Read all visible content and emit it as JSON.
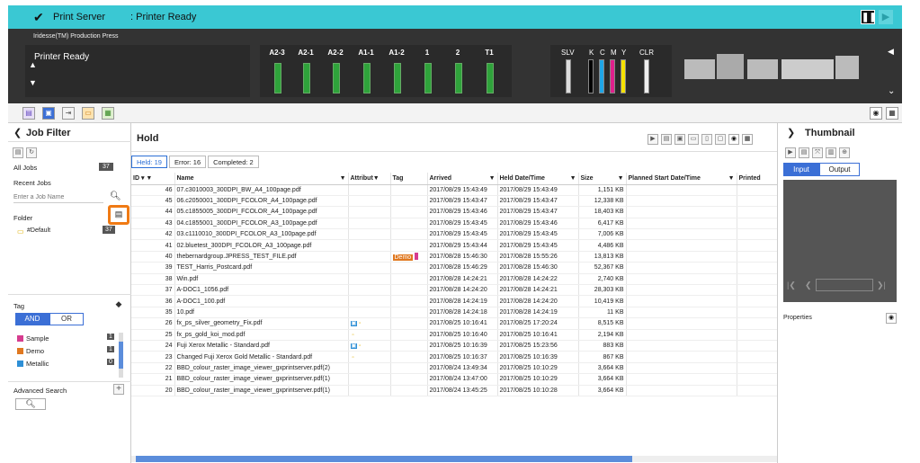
{
  "app": {
    "title": "Print Server",
    "status": ": Printer Ready",
    "product": "Iridesse(TM) Production Press",
    "printer_state": "Printer Ready"
  },
  "trays": [
    {
      "label": "A2-3"
    },
    {
      "label": "A2-1"
    },
    {
      "label": "A2-2"
    },
    {
      "label": "A1-1"
    },
    {
      "label": "A1-2"
    },
    {
      "label": "1"
    },
    {
      "label": "2"
    },
    {
      "label": "T1"
    }
  ],
  "toners": {
    "slv": "SLV",
    "k": "K",
    "c": "C",
    "m": "M",
    "y": "Y",
    "clr": "CLR"
  },
  "left": {
    "title": "Job Filter",
    "all_jobs": "All Jobs",
    "all_count": "37",
    "recent": "Recent Jobs",
    "search_placeholder": "Enter a Job Name",
    "folder": "Folder",
    "default_folder": "#Default",
    "default_count": "37",
    "tag": "Tag",
    "and": "AND",
    "or": "OR",
    "tags": [
      {
        "name": "Sample",
        "count": "1",
        "color": "#d63c8f"
      },
      {
        "name": "Demo",
        "count": "1",
        "color": "#e07820"
      },
      {
        "name": "Metallic",
        "count": "0",
        "color": "#2e8fd6"
      }
    ],
    "advanced": "Advanced Search"
  },
  "center": {
    "title": "Hold",
    "held": "Held: 19",
    "error": "Error: 16",
    "completed": "Completed: 2",
    "columns": {
      "id": "ID",
      "name": "Name",
      "attrib": "Attribut",
      "tag": "Tag",
      "arrived": "Arrived",
      "held": "Held Date/Time",
      "size": "Size",
      "planned": "Planned Start Date/Time",
      "printed": "Printed"
    },
    "rows": [
      {
        "id": "46",
        "name": "07.c3010003_300DPI_BW_A4_100page.pdf",
        "arrived": "2017/08/29 15:43:49",
        "held": "2017/08/29 15:43:49",
        "size": "1,151 KB",
        "tag": ""
      },
      {
        "id": "45",
        "name": "06.c2050001_300DPI_FCOLOR_A4_100page.pdf",
        "arrived": "2017/08/29 15:43:47",
        "held": "2017/08/29 15:43:47",
        "size": "12,338 KB",
        "tag": ""
      },
      {
        "id": "44",
        "name": "05.c1855005_300DPI_FCOLOR_A4_100page.pdf",
        "arrived": "2017/08/29 15:43:46",
        "held": "2017/08/29 15:43:47",
        "size": "18,403 KB",
        "tag": ""
      },
      {
        "id": "43",
        "name": "04.c1855001_300DPI_FCOLOR_A3_100page.pdf",
        "arrived": "2017/08/29 15:43:45",
        "held": "2017/08/29 15:43:46",
        "size": "6,417 KB",
        "tag": ""
      },
      {
        "id": "42",
        "name": "03.c1110010_300DPI_FCOLOR_A3_100page.pdf",
        "arrived": "2017/08/29 15:43:45",
        "held": "2017/08/29 15:43:45",
        "size": "7,006 KB",
        "tag": ""
      },
      {
        "id": "41",
        "name": "02.bluetest_300DPI_FCOLOR_A3_100page.pdf",
        "arrived": "2017/08/29 15:43:44",
        "held": "2017/08/29 15:43:45",
        "size": "4,486 KB",
        "tag": ""
      },
      {
        "id": "40",
        "name": "thebernardgroup.JPRESS_TEST_FILE.pdf",
        "arrived": "2017/08/28 15:46:30",
        "held": "2017/08/28 15:55:26",
        "size": "13,813 KB",
        "tag": "Demo"
      },
      {
        "id": "39",
        "name": "TEST_Harris_Postcard.pdf",
        "arrived": "2017/08/28 15:46:29",
        "held": "2017/08/28 15:46:30",
        "size": "52,367 KB",
        "tag": ""
      },
      {
        "id": "38",
        "name": "Win.pdf",
        "arrived": "2017/08/28 14:24:21",
        "held": "2017/08/28 14:24:22",
        "size": "2,740 KB",
        "tag": ""
      },
      {
        "id": "37",
        "name": "A-DOC1_1056.pdf",
        "arrived": "2017/08/28 14:24:20",
        "held": "2017/08/28 14:24:21",
        "size": "28,303 KB",
        "tag": ""
      },
      {
        "id": "36",
        "name": "A-DOC1_100.pdf",
        "arrived": "2017/08/28 14:24:19",
        "held": "2017/08/28 14:24:20",
        "size": "10,419 KB",
        "tag": ""
      },
      {
        "id": "35",
        "name": "10.pdf",
        "arrived": "2017/08/28 14:24:18",
        "held": "2017/08/28 14:24:19",
        "size": "11 KB",
        "tag": ""
      },
      {
        "id": "26",
        "name": "fx_ps_silver_geometry_Fix.pdf",
        "arrived": "2017/08/25 10:16:41",
        "held": "2017/08/25 17:20:24",
        "size": "8,515 KB",
        "tag": ""
      },
      {
        "id": "25",
        "name": "fx_ps_gold_koi_mod.pdf",
        "arrived": "2017/08/25 10:16:40",
        "held": "2017/08/25 10:16:41",
        "size": "2,194 KB",
        "tag": ""
      },
      {
        "id": "24",
        "name": "Fuji Xerox Metallic - Standard.pdf",
        "arrived": "2017/08/25 10:16:39",
        "held": "2017/08/25 15:23:56",
        "size": "883 KB",
        "tag": ""
      },
      {
        "id": "23",
        "name": "Changed Fuji Xerox Gold Metallic - Standard.pdf",
        "arrived": "2017/08/25 10:16:37",
        "held": "2017/08/25 10:16:39",
        "size": "867 KB",
        "tag": ""
      },
      {
        "id": "22",
        "name": "BBD_colour_raster_image_viewer_gxprintserver.pdf(2)",
        "arrived": "2017/08/24 13:49:34",
        "held": "2017/08/25 10:10:29",
        "size": "3,664 KB",
        "tag": ""
      },
      {
        "id": "21",
        "name": "BBD_colour_raster_image_viewer_gxprintserver.pdf(1)",
        "arrived": "2017/08/24 13:47:00",
        "held": "2017/08/25 10:10:29",
        "size": "3,664 KB",
        "tag": ""
      },
      {
        "id": "20",
        "name": "BBD_colour_raster_image_viewer_gxprintserver.pdf(1)",
        "arrived": "2017/08/24 13:45:25",
        "held": "2017/08/25 10:10:28",
        "size": "3,664 KB",
        "tag": ""
      }
    ]
  },
  "right": {
    "title": "Thumbnail",
    "input": "Input",
    "output": "Output",
    "properties": "Properties"
  }
}
